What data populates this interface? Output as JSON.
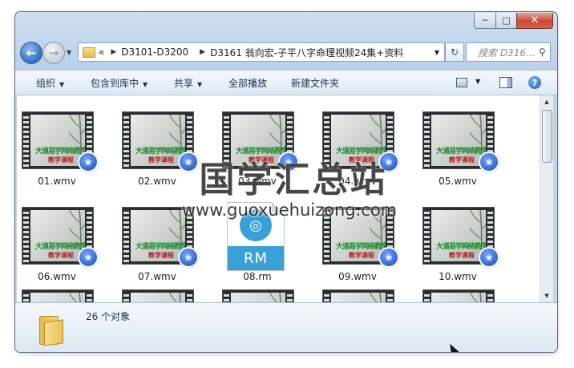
{
  "nav": {
    "back_icon": "back-arrow-icon",
    "forward_icon": "forward-arrow-icon",
    "address": {
      "overflow": "«",
      "crumbs": [
        "D3101-D3200",
        "D3161 翁向宏-子平八字命理视频24集+资料"
      ]
    },
    "search_placeholder": "搜索 D316..."
  },
  "toolbar": {
    "organize": "组织",
    "include_in_library": "包含到库中",
    "share": "共享",
    "play_all": "全部播放",
    "new_folder": "新建文件夹"
  },
  "files": [
    {
      "name": "01.wmv",
      "type": "wmv"
    },
    {
      "name": "02.wmv",
      "type": "wmv"
    },
    {
      "name": "03.wmv",
      "type": "wmv"
    },
    {
      "name": "04.wmv",
      "type": "wmv"
    },
    {
      "name": "05.wmv",
      "type": "wmv"
    },
    {
      "name": "06.wmv",
      "type": "wmv"
    },
    {
      "name": "07.wmv",
      "type": "wmv"
    },
    {
      "name": "08.rm",
      "type": "rm"
    },
    {
      "name": "09.wmv",
      "type": "wmv"
    },
    {
      "name": "10.wmv",
      "type": "wmv"
    },
    {
      "name": "",
      "type": "wmv"
    },
    {
      "name": "",
      "type": "wmv"
    },
    {
      "name": "",
      "type": "wmv"
    },
    {
      "name": "",
      "type": "wmv"
    },
    {
      "name": "",
      "type": "wmv"
    }
  ],
  "thumbnail": {
    "line1": "大道易学网络教学",
    "line2": "教学课程"
  },
  "rm_icon_text": "RM",
  "status": {
    "count": "26 个对象"
  },
  "watermark": {
    "line1": "国学汇总站",
    "line2": "www.guoxuehuizong.com"
  },
  "colors": {
    "accent": "#3aa0d8",
    "close": "#c7483a"
  }
}
